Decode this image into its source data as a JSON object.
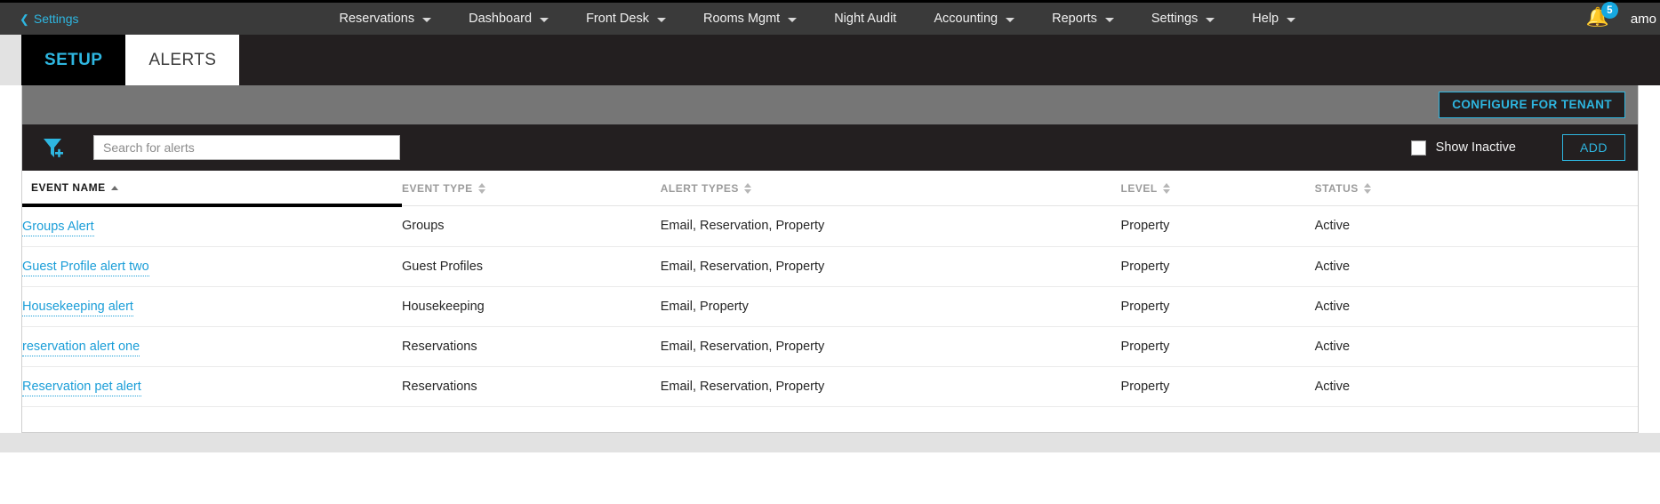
{
  "topnav": {
    "back_label": "Settings",
    "back_icon": "chevron-left-icon",
    "items": [
      {
        "label": "Reservations",
        "has_caret": true
      },
      {
        "label": "Dashboard",
        "has_caret": true
      },
      {
        "label": "Front Desk",
        "has_caret": true
      },
      {
        "label": "Rooms Mgmt",
        "has_caret": true
      },
      {
        "label": "Night Audit",
        "has_caret": false
      },
      {
        "label": "Accounting",
        "has_caret": true
      },
      {
        "label": "Reports",
        "has_caret": true
      },
      {
        "label": "Settings",
        "has_caret": true
      },
      {
        "label": "Help",
        "has_caret": true
      }
    ],
    "notifications": {
      "icon": "bell-icon",
      "count": "5",
      "badge_color": "#16a8e0"
    },
    "account_label": "amo"
  },
  "tabs": [
    {
      "label": "SETUP",
      "active": false
    },
    {
      "label": "ALERTS",
      "active": true
    }
  ],
  "toolbar": {
    "configure_label": "CONFIGURE FOR TENANT",
    "accent_color": "#2eb6e0"
  },
  "search": {
    "filter_icon": "filter-add-icon",
    "placeholder": "Search for alerts",
    "value": "",
    "show_inactive_label": "Show Inactive",
    "show_inactive_checked": false,
    "add_label": "ADD"
  },
  "table": {
    "columns": [
      {
        "label": "EVENT NAME",
        "sorted": true,
        "direction": "asc"
      },
      {
        "label": "EVENT TYPE",
        "sorted": false,
        "direction": "none"
      },
      {
        "label": "ALERT TYPES",
        "sorted": false,
        "direction": "none"
      },
      {
        "label": "LEVEL",
        "sorted": false,
        "direction": "none"
      },
      {
        "label": "STATUS",
        "sorted": false,
        "direction": "none"
      }
    ],
    "rows": [
      {
        "event_name": "Groups Alert",
        "event_type": "Groups",
        "alert_types": "Email, Reservation, Property",
        "level": "Property",
        "status": "Active"
      },
      {
        "event_name": "Guest Profile alert two",
        "event_type": "Guest Profiles",
        "alert_types": "Email, Reservation, Property",
        "level": "Property",
        "status": "Active"
      },
      {
        "event_name": "Housekeeping alert",
        "event_type": "Housekeeping",
        "alert_types": "Email, Property",
        "level": "Property",
        "status": "Active"
      },
      {
        "event_name": "reservation alert one",
        "event_type": "Reservations",
        "alert_types": "Email, Reservation, Property",
        "level": "Property",
        "status": "Active"
      },
      {
        "event_name": "Reservation pet alert",
        "event_type": "Reservations",
        "alert_types": "Email, Reservation, Property",
        "level": "Property",
        "status": "Active"
      }
    ]
  }
}
